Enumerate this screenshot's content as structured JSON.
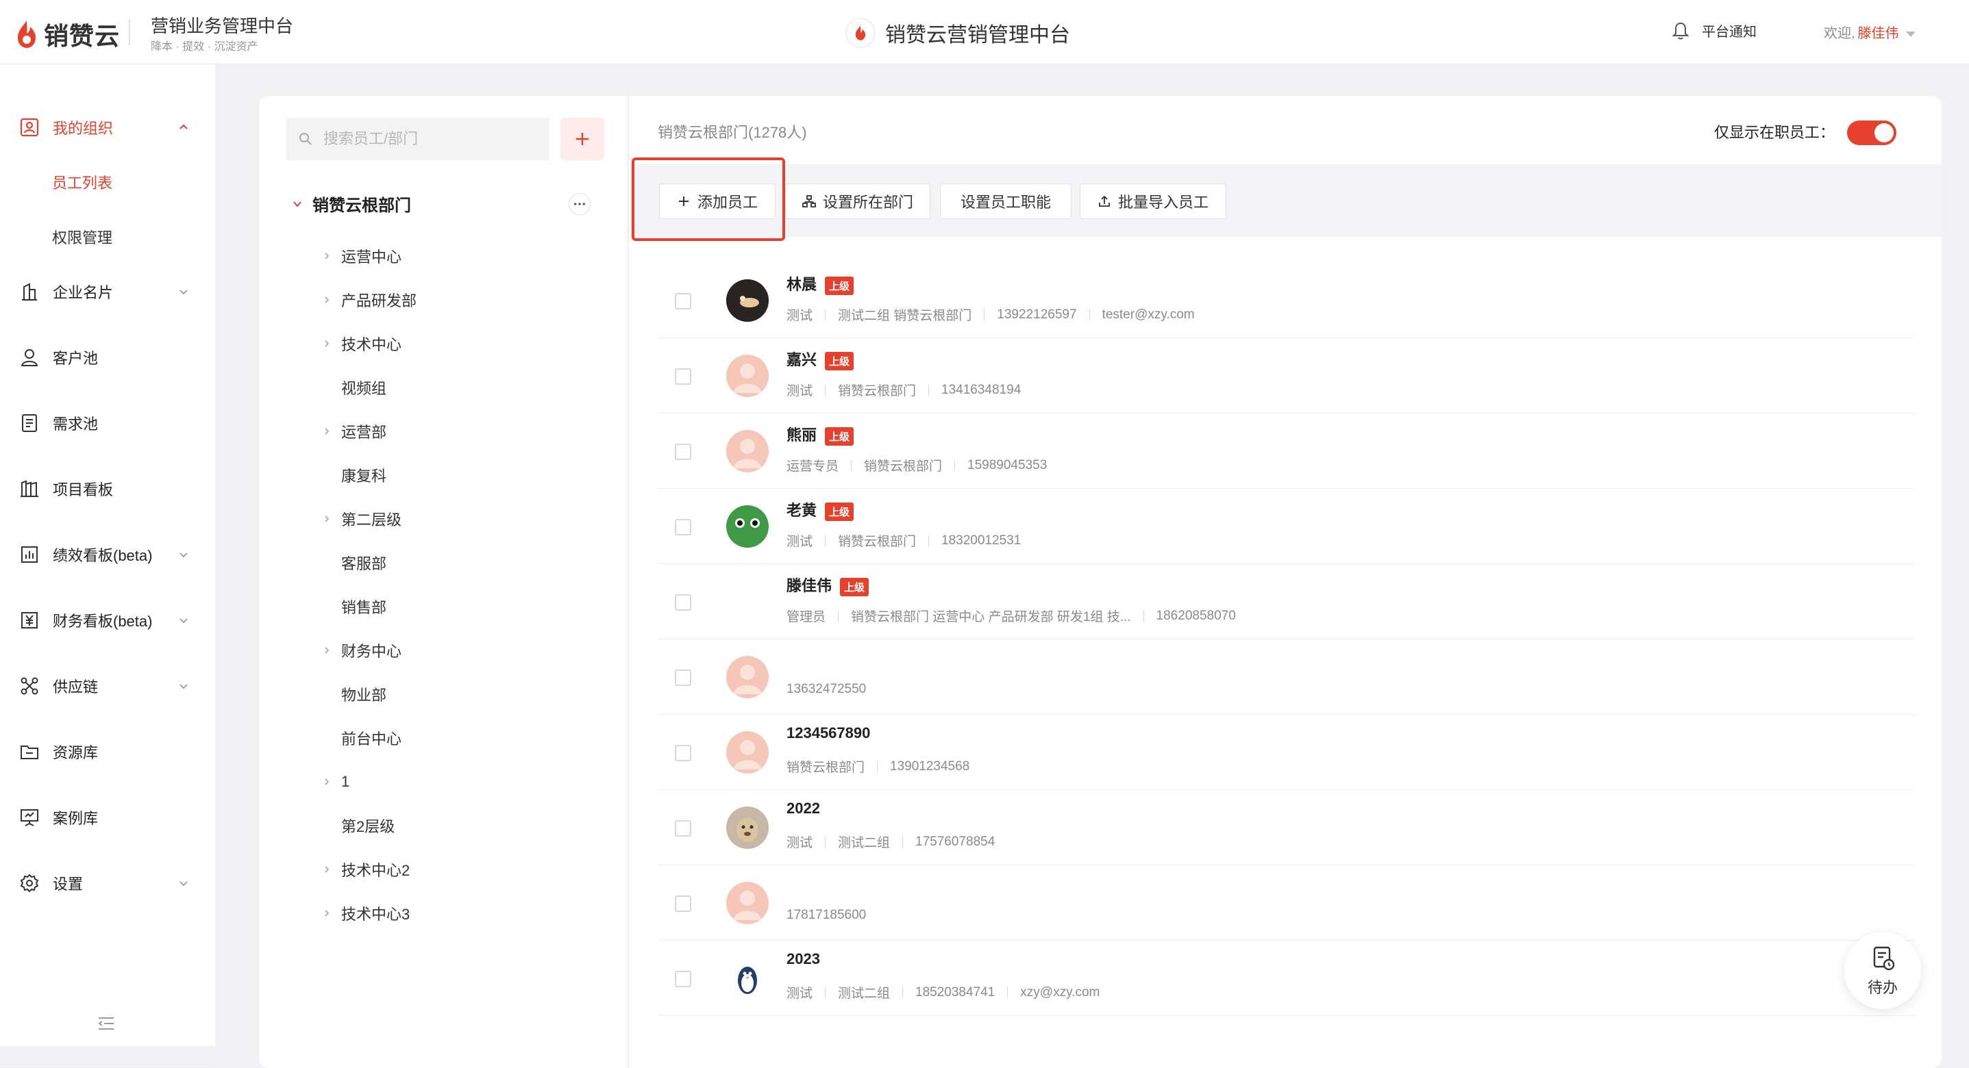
{
  "brand": {
    "logo_text": "销赞云",
    "app_title": "营销业务管理中台",
    "app_subtitle": "降本 · 提效 · 沉淀资产",
    "center_title": "销赞云营销管理中台",
    "accent": "#e5412c"
  },
  "header": {
    "notice": "平台通知",
    "welcome": "欢迎,",
    "user": "滕佳伟"
  },
  "sidebar": {
    "my_org": "我的组织",
    "sub_items": [
      "员工列表",
      "权限管理"
    ],
    "items": [
      "企业名片",
      "客户池",
      "需求池",
      "项目看板",
      "绩效看板(beta)",
      "财务看板(beta)",
      "供应链",
      "资源库",
      "案例库",
      "设置"
    ]
  },
  "tree": {
    "search_placeholder": "搜索员工/部门",
    "root": "销赞云根部门",
    "nodes": [
      "运营中心",
      "产品研发部",
      "技术中心",
      "视频组",
      "运营部",
      "康复科",
      "第二层级",
      "客服部",
      "销售部",
      "财务中心",
      "物业部",
      "前台中心",
      "1",
      "第2层级",
      "技术中心2",
      "技术中心3"
    ]
  },
  "main": {
    "dept_title": "销赞云根部门(1278人)",
    "only_active": "仅显示在职员工：",
    "toolbar": {
      "add": "添加员工",
      "set_dept": "设置所在部门",
      "set_role": "设置员工职能",
      "import": "批量导入员工"
    }
  },
  "superior_tag": "上级",
  "employees": [
    {
      "name": "林晨",
      "tag": true,
      "meta": [
        "测试",
        "测试二组 销赞云根部门",
        "13922126597",
        "tester@xzy.com"
      ]
    },
    {
      "name": "嘉兴",
      "tag": true,
      "meta": [
        "测试",
        "销赞云根部门",
        "13416348194"
      ]
    },
    {
      "name": "熊丽",
      "tag": true,
      "meta": [
        "运营专员",
        "销赞云根部门",
        "15989045353"
      ]
    },
    {
      "name": "老黄",
      "tag": true,
      "meta": [
        "测试",
        "销赞云根部门",
        "18320012531"
      ]
    },
    {
      "name": "滕佳伟",
      "tag": true,
      "meta": [
        "管理员",
        "销赞云根部门 运营中心 产品研发部 研发1组 技...",
        "18620858070"
      ]
    },
    {
      "name": "",
      "tag": false,
      "meta": [
        "13632472550"
      ]
    },
    {
      "name": "1234567890",
      "tag": false,
      "meta": [
        "销赞云根部门",
        "13901234568"
      ]
    },
    {
      "name": "2022",
      "tag": false,
      "meta": [
        "测试",
        "测试二组",
        "17576078854"
      ]
    },
    {
      "name": "",
      "tag": false,
      "meta": [
        "17817185600"
      ]
    },
    {
      "name": "2023",
      "tag": false,
      "meta": [
        "测试",
        "测试二组",
        "18520384741",
        "xzy@xzy.com"
      ]
    }
  ],
  "todo": {
    "label": "待办"
  }
}
